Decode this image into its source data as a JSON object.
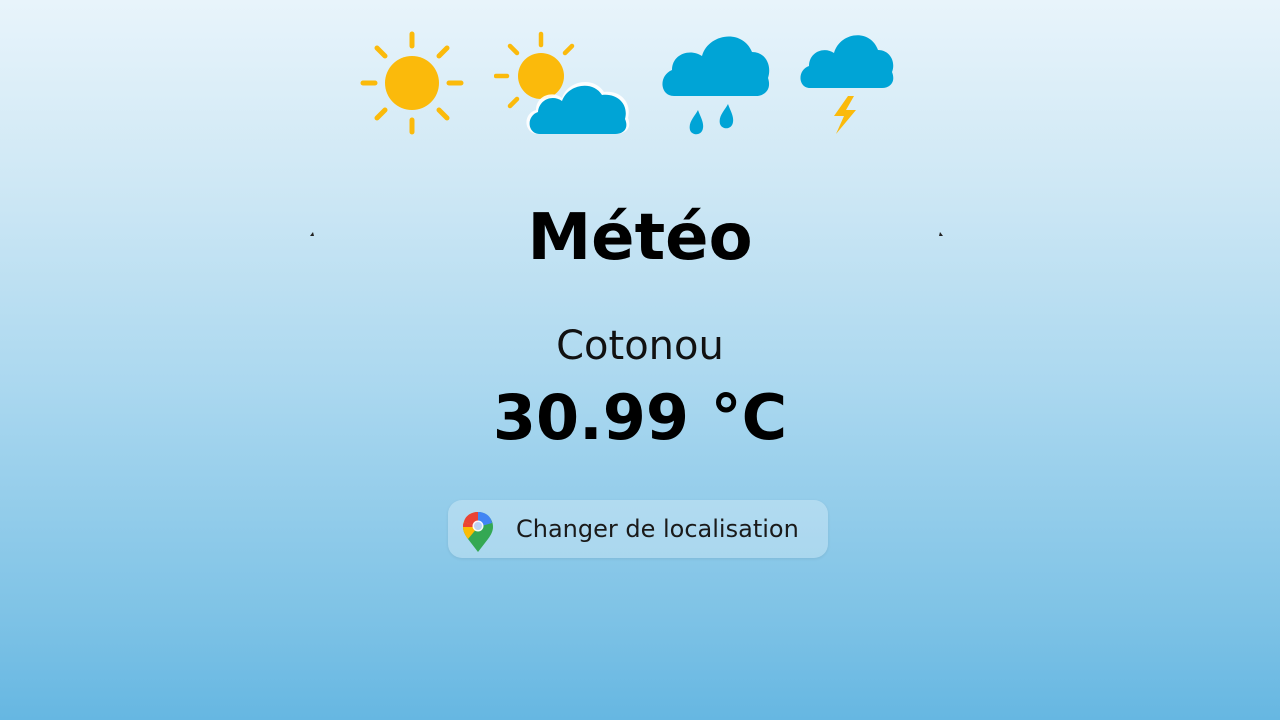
{
  "header": {
    "icons": [
      "sun-icon",
      "partly-cloudy-icon",
      "rain-cloud-icon",
      "thunderstorm-icon"
    ]
  },
  "title": "Météo",
  "location": {
    "city": "Cotonou",
    "temperature": "30.99 °C"
  },
  "actions": {
    "change_location_label": "Changer de localisation",
    "change_location_icon": "map-pin-icon"
  },
  "colors": {
    "sun": "#FBBA0B",
    "cloud": "#00A4D6",
    "bolt": "#FBBA0B",
    "background_top": "#e8f4fb",
    "background_bottom": "#66b7e2"
  }
}
